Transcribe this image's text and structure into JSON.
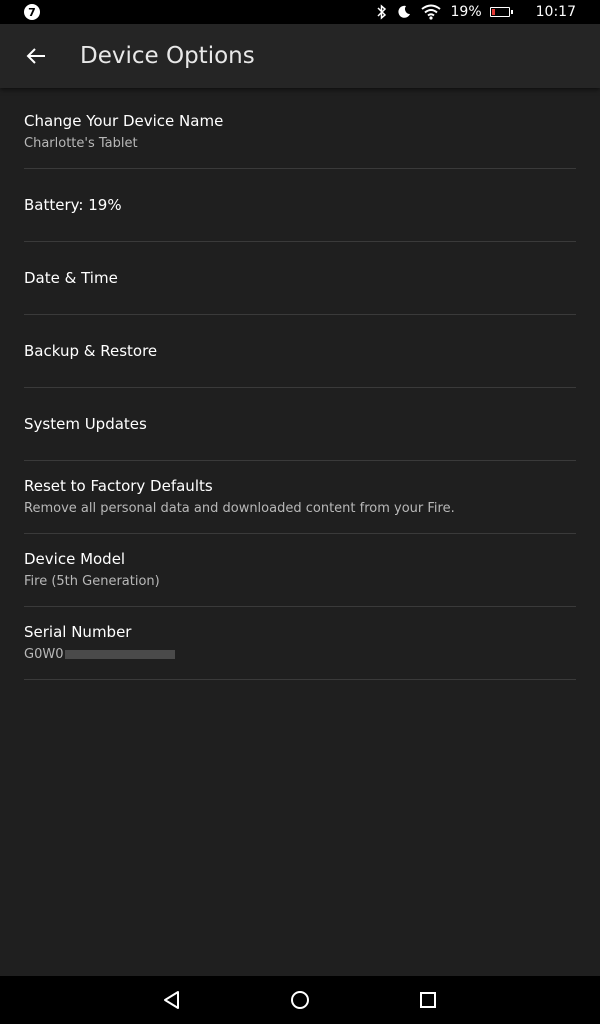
{
  "status_bar": {
    "notification_count": "7",
    "battery_percent": "19%",
    "battery_level": 0.19,
    "time": "10:17",
    "icons": [
      "bluetooth-icon",
      "moon-icon",
      "wifi-icon",
      "battery-icon"
    ]
  },
  "header": {
    "title": "Device Options",
    "back_icon": "arrow-left-icon"
  },
  "items": [
    {
      "title": "Change Your Device Name",
      "subtitle": "Charlotte's Tablet"
    },
    {
      "title": "Battery: 19%",
      "subtitle": ""
    },
    {
      "title": "Date & Time",
      "subtitle": ""
    },
    {
      "title": "Backup & Restore",
      "subtitle": ""
    },
    {
      "title": "System Updates",
      "subtitle": ""
    },
    {
      "title": "Reset to Factory Defaults",
      "subtitle": "Remove all personal data and downloaded content from your Fire."
    },
    {
      "title": "Device Model",
      "subtitle": "Fire (5th Generation)"
    },
    {
      "title": "Serial Number",
      "subtitle": "G0W0"
    }
  ],
  "nav_bar": {
    "back": "back-triangle-icon",
    "home": "home-circle-icon",
    "recents": "recents-square-icon"
  },
  "colors": {
    "background": "#1f1f1f",
    "app_bar": "#252525",
    "battery_low": "#e53935"
  }
}
